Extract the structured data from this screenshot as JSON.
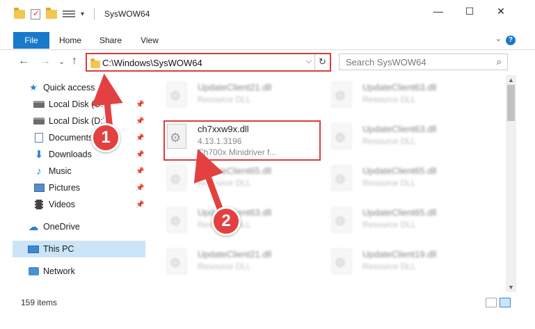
{
  "window": {
    "title": "SysWOW64",
    "minimize": "—",
    "maximize": "☐",
    "close": "✕"
  },
  "ribbon": {
    "tabs": [
      "File",
      "Home",
      "Share",
      "View"
    ],
    "help": "?"
  },
  "nav": {
    "back": "←",
    "forward": "→",
    "recent": "⌄",
    "up": "↑"
  },
  "address": {
    "path": "C:\\Windows\\SysWOW64",
    "dropdown": "⌵",
    "refresh": "↻"
  },
  "search": {
    "placeholder": "Search SysWOW64",
    "icon": "⌕"
  },
  "sidebar": {
    "items": [
      {
        "label": "Quick access",
        "icon": "star-icon"
      },
      {
        "label": "Local Disk (C:)",
        "icon": "drive-icon",
        "pinned": true
      },
      {
        "label": "Local Disk (D:)",
        "icon": "drive-icon",
        "pinned": true
      },
      {
        "label": "Documents",
        "icon": "document-icon",
        "pinned": true
      },
      {
        "label": "Downloads",
        "icon": "download-icon",
        "pinned": true
      },
      {
        "label": "Music",
        "icon": "music-icon",
        "pinned": true
      },
      {
        "label": "Pictures",
        "icon": "pictures-icon",
        "pinned": true
      },
      {
        "label": "Videos",
        "icon": "video-icon",
        "pinned": true
      },
      {
        "label": "OneDrive",
        "icon": "cloud-icon"
      },
      {
        "label": "This PC",
        "icon": "computer-icon",
        "selected": true
      },
      {
        "label": "Network",
        "icon": "network-icon"
      }
    ],
    "pin_glyph": "📌"
  },
  "files": [
    {
      "name": "UpdateClient21.dll",
      "desc": "Resource DLL",
      "blurred": true
    },
    {
      "name": "UpdateClient63.dll",
      "desc": "Resource DLL",
      "blurred": true
    },
    {
      "name": "ch7xxw9x.dll",
      "version": "4.13.1.3196",
      "desc": "Ch700x Minidriver f...",
      "blurred": false
    },
    {
      "name": "UpdateClient63.dll",
      "desc": "Resource DLL",
      "blurred": true
    },
    {
      "name": "UpdateClient65.dll",
      "desc": "Resource DLL",
      "blurred": true
    },
    {
      "name": "UpdateClient65.dll",
      "desc": "Resource DLL",
      "blurred": true
    },
    {
      "name": "UpdateClient63.dll",
      "desc": "Resource DLL",
      "blurred": true
    },
    {
      "name": "UpdateClient65.dll",
      "desc": "Resource DLL",
      "blurred": true
    },
    {
      "name": "UpdateClient21.dll",
      "desc": "Resource DLL",
      "blurred": true
    },
    {
      "name": "UpdateClient19.dll",
      "desc": "Resource DLL",
      "blurred": true
    }
  ],
  "status": {
    "item_count": "159 items"
  },
  "callouts": [
    "1",
    "2"
  ],
  "colors": {
    "accent": "#1979ca",
    "highlight": "#e03b3b",
    "selected": "#cce4f7"
  }
}
